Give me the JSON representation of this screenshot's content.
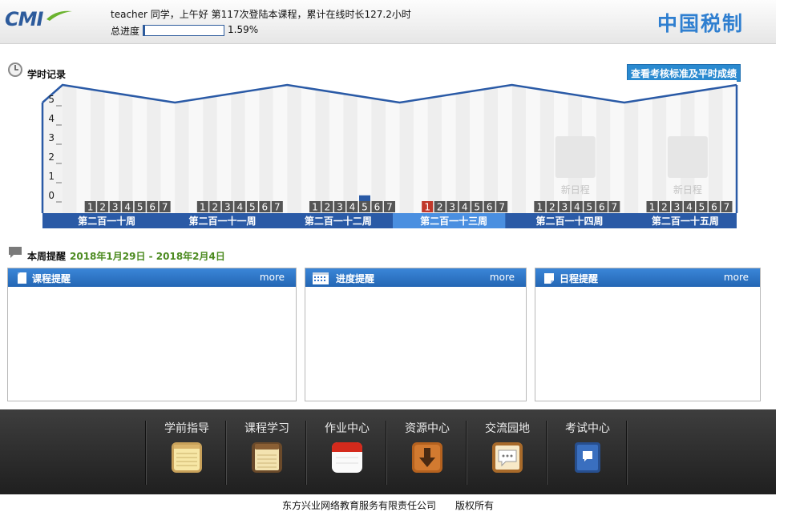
{
  "header": {
    "logo_text": "CMI",
    "greeting": "teacher 同学，上午好 第117次登陆本课程，累计在线时长127.2小时",
    "progress_label": "总进度",
    "progress_percent": "1.59%",
    "progress_value": 1.59,
    "brand_name": "中国税制"
  },
  "study_record": {
    "title": "学时记录",
    "view_standard_button": "查看考核标准及平时成绩",
    "y_ticks": [
      "5",
      "4",
      "3",
      "2",
      "1",
      "0"
    ],
    "weeks": [
      {
        "label": "第二百一十周",
        "days": [
          "1",
          "2",
          "3",
          "4",
          "5",
          "6",
          "7"
        ],
        "highlight_day": null,
        "bars": [
          0,
          0,
          0,
          0,
          0,
          0,
          0
        ],
        "current": false,
        "placeholder": ""
      },
      {
        "label": "第二百一十一周",
        "days": [
          "1",
          "2",
          "3",
          "4",
          "5",
          "6",
          "7"
        ],
        "highlight_day": null,
        "bars": [
          0,
          0,
          0,
          0,
          0,
          0,
          0
        ],
        "current": false,
        "placeholder": ""
      },
      {
        "label": "第二百一十二周",
        "days": [
          "1",
          "2",
          "3",
          "4",
          "5",
          "6",
          "7"
        ],
        "highlight_day": null,
        "bars": [
          0,
          0,
          0,
          0,
          0.3,
          0,
          0
        ],
        "current": false,
        "placeholder": ""
      },
      {
        "label": "第二百一十三周",
        "days": [
          "1",
          "2",
          "3",
          "4",
          "5",
          "6",
          "7"
        ],
        "highlight_day": 0,
        "bars": [
          0,
          0,
          0,
          0,
          0,
          0,
          0
        ],
        "current": true,
        "placeholder": ""
      },
      {
        "label": "第二百一十四周",
        "days": [
          "1",
          "2",
          "3",
          "4",
          "5",
          "6",
          "7"
        ],
        "highlight_day": null,
        "bars": [
          0,
          0,
          0,
          0,
          0,
          0,
          0
        ],
        "current": false,
        "placeholder": "新日程"
      },
      {
        "label": "第二百一十五周",
        "days": [
          "1",
          "2",
          "3",
          "4",
          "5",
          "6",
          "7"
        ],
        "highlight_day": null,
        "bars": [
          0,
          0,
          0,
          0,
          0,
          0,
          0
        ],
        "current": false,
        "placeholder": "新日程"
      }
    ],
    "colors": {
      "frame": "#2a5aa6",
      "current_week": "#4a8fe0",
      "highlight_day": "#c0392b",
      "day_box": "#555555"
    }
  },
  "weekly_reminder": {
    "title": "本周提醒",
    "date_range": "2018年1月29日 - 2018年2月4日",
    "panels": [
      {
        "title": "课程提醒",
        "more": "more",
        "icon": "document-icon"
      },
      {
        "title": "进度提醒",
        "more": "more",
        "icon": "calendar-icon"
      },
      {
        "title": "日程提醒",
        "more": "more",
        "icon": "note-icon"
      }
    ]
  },
  "nav": [
    {
      "label": "学前指导",
      "icon": "notepad-icon"
    },
    {
      "label": "课程学习",
      "icon": "notes-icon"
    },
    {
      "label": "作业中心",
      "icon": "calendar-red-icon"
    },
    {
      "label": "资源中心",
      "icon": "download-icon"
    },
    {
      "label": "交流园地",
      "icon": "chat-board-icon"
    },
    {
      "label": "考试中心",
      "icon": "book-icon"
    }
  ],
  "footer": {
    "copyright": "东方兴业网络教育服务有限责任公司　　版权所有"
  }
}
